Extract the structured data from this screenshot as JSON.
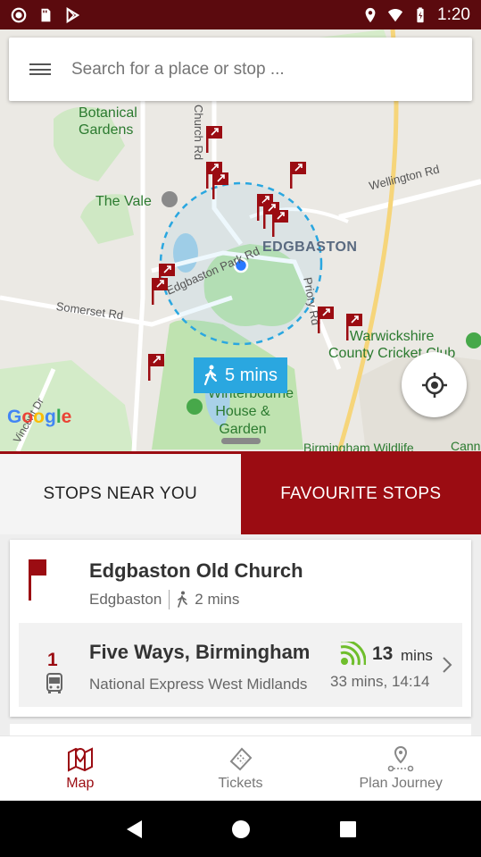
{
  "status_bar": {
    "time": "1:20",
    "icons": [
      "record-icon",
      "sd-card-icon",
      "play-store-icon",
      "location-icon",
      "wifi-icon",
      "battery-icon"
    ]
  },
  "search": {
    "placeholder": "Search for a place or stop ..."
  },
  "map": {
    "labels": {
      "botanical": "Botanical\nGardens",
      "vale": "The Vale",
      "edgbaston": "EDGBASTON",
      "wellington": "Wellington Rd",
      "park_rd": "Edgbaston Park Rd",
      "somerset": "Somerset Rd",
      "priory": "Priory Rd",
      "warwickshire": "Warwickshire\nCounty Cricket Club",
      "winterbourne": "Winterbourne\nHouse &\nGarden",
      "wildlife": "Birmingham Wildlife",
      "vincent": "Vincent Dr",
      "ridge": "Church Rd",
      "cann": "Cann"
    },
    "walk_badge": "5 mins",
    "google_logo": "Google"
  },
  "tabs": {
    "near": "STOPS NEAR YOU",
    "favourite": "FAVOURITE STOPS"
  },
  "stop": {
    "name": "Edgbaston Old Church",
    "area": "Edgbaston",
    "walk_time": "2 mins",
    "service": {
      "route": "1",
      "destination": "Five Ways, Birmingham",
      "operator": "National Express West Midlands",
      "due_value": "13",
      "due_unit": "mins",
      "next": "33 mins, 14:14"
    }
  },
  "bottom_nav": {
    "map": "Map",
    "tickets": "Tickets",
    "plan": "Plan Journey"
  },
  "colors": {
    "brand": "#9b0c12",
    "status_bar": "#5b0a0e",
    "walk_badge": "#2aa7e0",
    "live_green": "#6fbe2c"
  }
}
